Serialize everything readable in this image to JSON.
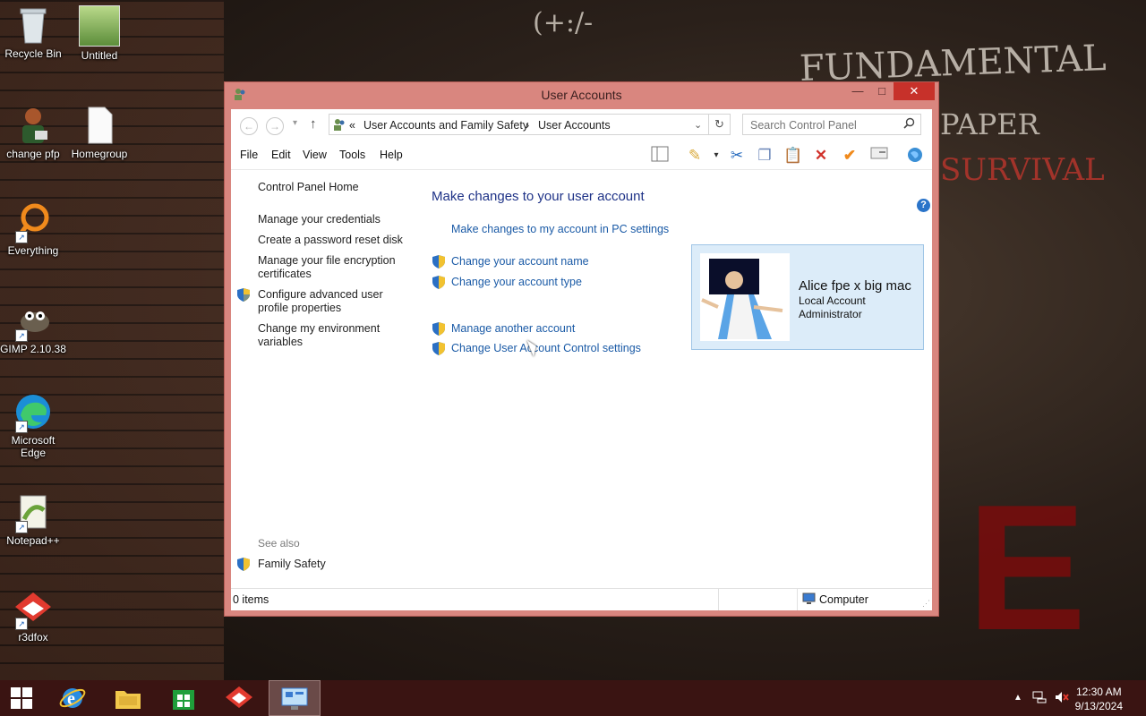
{
  "desktop": {
    "icons": [
      {
        "label": "Recycle Bin"
      },
      {
        "label": "Untitled"
      },
      {
        "label": "change pfp"
      },
      {
        "label": "Homegroup"
      },
      {
        "label": "Everything"
      },
      {
        "label": "GIMP 2.10.38"
      },
      {
        "label": "Microsoft Edge"
      },
      {
        "label": "Notepad++"
      },
      {
        "label": "r3dfox"
      }
    ],
    "wallpaper_text": [
      "(+:/-",
      "FUNDAMENTAL",
      "PAPER",
      "SURVIVAL"
    ]
  },
  "window": {
    "title": "User Accounts",
    "buttons": {
      "minimize": "—",
      "maximize": "□",
      "close": "✕"
    },
    "address": {
      "prefix": "«",
      "crumbs": [
        "User Accounts and Family Safety",
        "User Accounts"
      ],
      "separator": "›"
    },
    "search": {
      "placeholder": "Search Control Panel"
    },
    "menu": [
      "File",
      "Edit",
      "View",
      "Tools",
      "Help"
    ],
    "left_nav": {
      "home": "Control Panel Home",
      "links": [
        "Manage your credentials",
        "Create a password reset disk",
        "Manage your file encryption certificates",
        "Configure advanced user profile properties",
        "Change my environment variables"
      ],
      "see_also_label": "See also",
      "see_also": [
        "Family Safety"
      ]
    },
    "main": {
      "heading": "Make changes to your user account",
      "tasks": [
        "Make changes to my account in PC settings",
        "Change your account name",
        "Change your account type",
        "Manage another account",
        "Change User Account Control settings"
      ]
    },
    "account": {
      "name": "Alice fpe x big mac",
      "type": "Local Account",
      "role": "Administrator"
    },
    "status": {
      "items": "0 items",
      "location": "Computer"
    }
  },
  "taskbar": {
    "time": "12:30 AM",
    "date": "9/13/2024"
  },
  "colors": {
    "title_bar": "#d9867f",
    "close_button": "#c7312a",
    "link": "#1a5aa6",
    "heading": "#1e3287",
    "taskbar": "#3a1412"
  }
}
